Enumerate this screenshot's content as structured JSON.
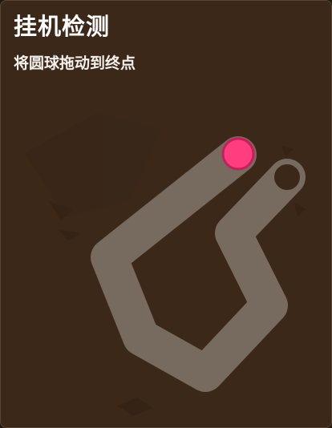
{
  "captcha": {
    "title": "挂机检测",
    "instruction": "将圆球拖动到终点"
  },
  "colors": {
    "panel_background": "#3b2819",
    "track": "#776a5f",
    "ball": "#ff3d7f",
    "ball_ring": "#c71f5b",
    "goal_ring": "#776a5f",
    "goal_inner": "#3b2819"
  }
}
